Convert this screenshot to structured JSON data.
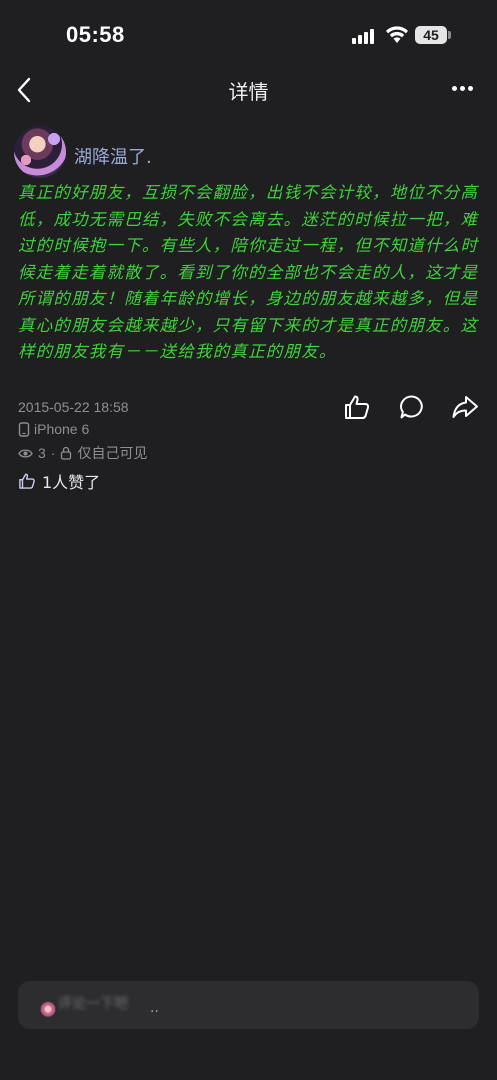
{
  "status_bar": {
    "time": "05:58",
    "battery": "45",
    "signal_icon": "signal-bars-icon",
    "wifi_icon": "wifi-icon"
  },
  "nav": {
    "title": "详情",
    "back_icon": "chevron-left-icon",
    "more_icon": "more-horizontal-icon"
  },
  "post": {
    "username": "湖降温了.",
    "text": "真正的好朋友，互损不会翻脸，出钱不会计较，地位不分高低，成功无需巴结，失败不会离去。迷茫的时候拉一把，难过的时候抱一下。有些人，陪你走过一程，但不知道什么时候走着走着就散了。看到了你的全部也不会走的人，这才是所谓的朋友！随着年龄的增长，身边的朋友越来越多，但是真心的朋友会越来越少，只有留下来的才是真正的朋友。这样的朋友我有－－送给我的真正的朋友。",
    "text_color": "#3fd23a",
    "date": "2015-05-22 18:58",
    "device": "iPhone 6",
    "views": "3",
    "separator": "·",
    "visibility": "仅自己可见",
    "likes": "1人赞了"
  },
  "comment_bar": {
    "placeholder": "评论一下吧",
    "dots": ".."
  },
  "colors": {
    "background": "#1f1f21",
    "username": "#9aa8d6",
    "meta": "#8e8e93"
  }
}
